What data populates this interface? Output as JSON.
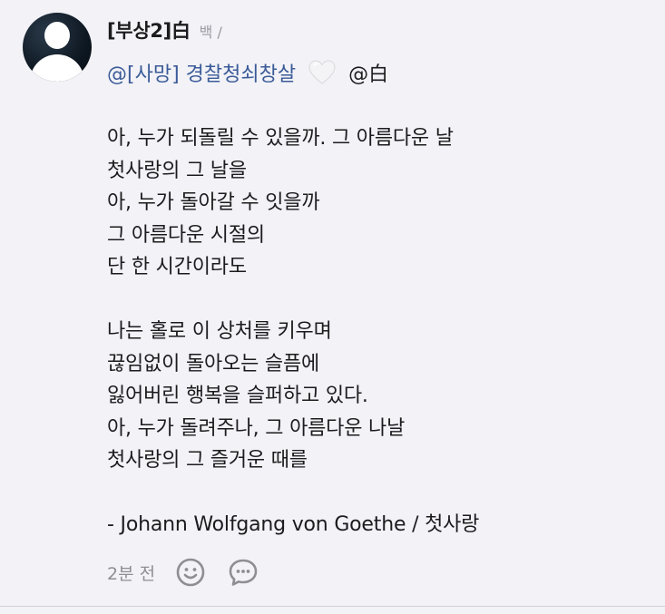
{
  "author": {
    "name": "[부상2]白",
    "sub": "백 /"
  },
  "mention": {
    "link": "@[사망] 경찰청쇠창살",
    "heart_icon": "white-heart-icon",
    "tail": "@白"
  },
  "body": {
    "text": "아, 누가 되돌릴 수 있을까. 그 아름다운 날\n첫사랑의 그 날을\n아, 누가 돌아갈 수 잇을까\n그 아름다운 시절의\n단 한 시간이라도\n\n나는 홀로 이 상처를 키우며\n끊임없이 돌아오는 슬픔에\n잃어버린 행복을 슬퍼하고 있다.\n아, 누가 돌려주나, 그 아름다운 나날\n첫사랑의 그 즐거운 때를\n\n- Johann Wolfgang von Goethe / 첫사랑"
  },
  "footer": {
    "timestamp": "2분 전",
    "react_icon": "smiley-icon",
    "comment_icon": "speech-bubble-icon"
  }
}
